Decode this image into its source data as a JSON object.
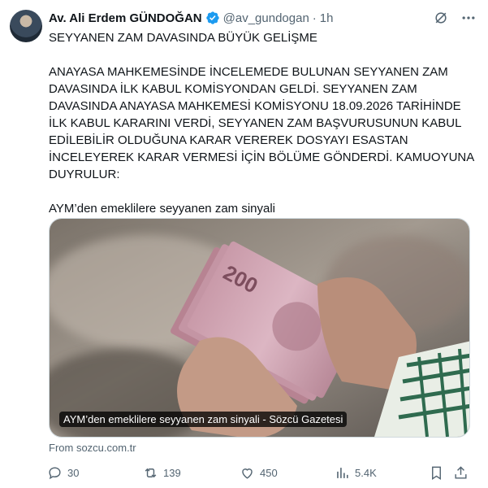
{
  "author": {
    "name": "Av. Ali Erdem GÜNDOĞAN",
    "handle": "@av_gundogan",
    "separator": "·",
    "time": "1h"
  },
  "tweet": {
    "headline": "SEYYANEN ZAM DAVASINDA BÜYÜK GELİŞME",
    "paragraph": "ANAYASA MAHKEMESİNDE İNCELEMEDE BULUNAN SEYYANEN ZAM DAVASINDA İLK KABUL KOMİSYONDAN GELDİ. SEYYANEN ZAM DAVASINDA ANAYASA MAHKEMESİ KOMİSYONU 18.09.2026 TARİHİNDE İLK KABUL KARARINI VERDİ, SEYYANEN ZAM BAŞVURUSUNUN KABUL EDİLEBİLİR OLDUĞUNA KARAR VEREREK DOSYAYI ESASTAN İNCELEYEREK KARAR VERMESİ İÇİN BÖLÜME GÖNDERDİ. KAMUOYUNA DUYRULUR:",
    "link_title": "AYM’den emeklilere seyyanen zam sinyali"
  },
  "card": {
    "caption": "AYM’den emeklilere seyyanen zam sinyali - Sözcü Gazetesi",
    "banknote_value": "200",
    "source": "From sozcu.com.tr"
  },
  "actions": {
    "replies": "30",
    "reposts": "139",
    "likes": "450",
    "views": "5.4K"
  },
  "colors": {
    "verified": "#1d9bf0",
    "secondary_text": "#536471"
  }
}
